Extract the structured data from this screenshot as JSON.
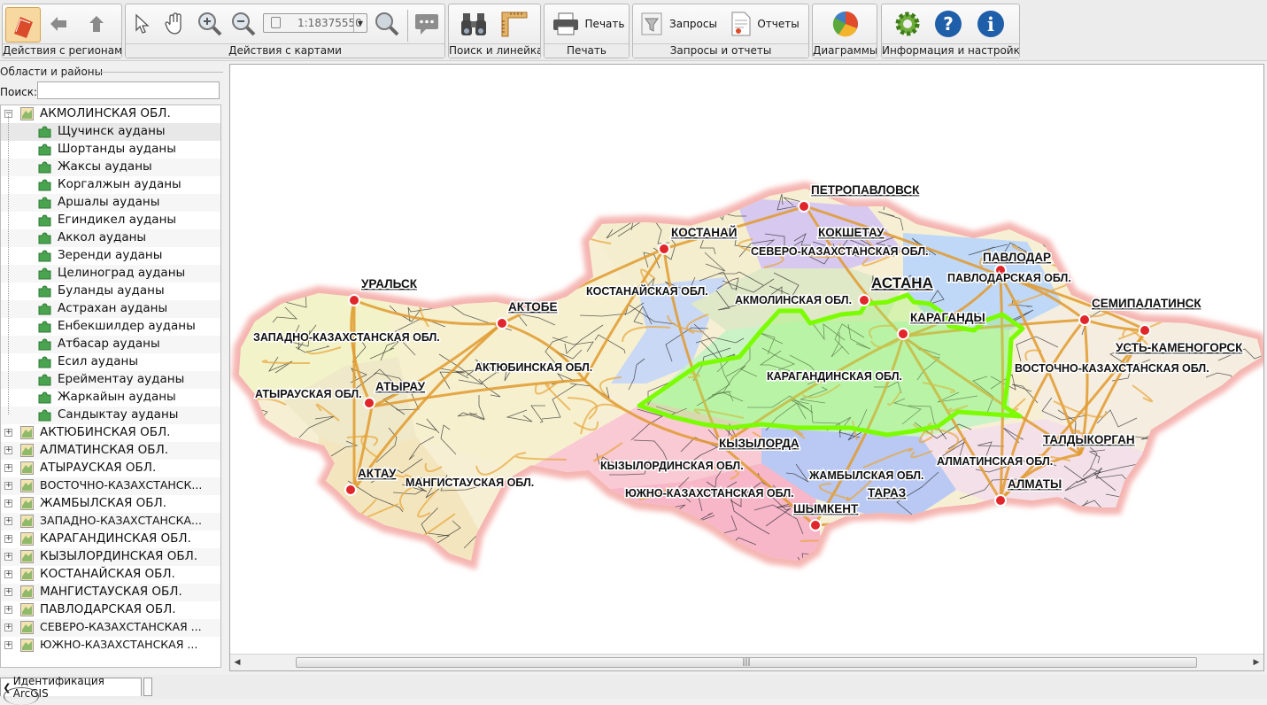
{
  "toolbar": {
    "groups": [
      {
        "label": "Действия с регионами"
      },
      {
        "label": "Действия с картами"
      },
      {
        "label": "Поиск и линейка"
      },
      {
        "label": "Печать"
      },
      {
        "label": "Запросы и отчеты"
      },
      {
        "label": "Диаграммы"
      },
      {
        "label": "Информация и настройки"
      }
    ],
    "scale_value": "1:18375550",
    "print_label": "Печать",
    "queries_label": "Запросы",
    "reports_label": "Отчеты"
  },
  "left_panel": {
    "title": "Области и районы",
    "search_label": "Поиск:",
    "search_value": "",
    "expanded_region": "АКМОЛИНСКАЯ ОБЛ.",
    "districts": [
      "Щучинск ауданы",
      "Шортанды ауданы",
      "Жаксы ауданы",
      "Коргалжын ауданы",
      "Аршалы ауданы",
      "Егиндикел ауданы",
      "Аккол ауданы",
      "Зеренди ауданы",
      "Целиноград ауданы",
      "Буланды ауданы",
      "Астрахан ауданы",
      "Енбекшилдер ауданы",
      "Атбасар ауданы",
      "Есил ауданы",
      "Ерейментау ауданы",
      "Жаркайын ауданы",
      "Сандыктау ауданы"
    ],
    "regions": [
      "АКТЮБИНСКАЯ ОБЛ.",
      "АЛМАТИНСКАЯ ОБЛ.",
      "АТЫРАУСКАЯ ОБЛ.",
      "ВОСТОЧНО-КАЗАХСТАНСК...",
      "ЖАМБЫЛСКАЯ ОБЛ.",
      "ЗАПАДНО-КАЗАХСТАНСКА...",
      "КАРАГАНДИНСКАЯ ОБЛ.",
      "КЫЗЫЛОРДИНСКАЯ ОБЛ.",
      "КОСТАНАЙСКАЯ ОБЛ.",
      "МАНГИСТАУСКАЯ ОБЛ.",
      "ПАВЛОДАРСКАЯ ОБЛ.",
      "СЕВЕРО-КАЗАХСТАНСКАЯ ...",
      "ЮЖНО-КАЗАХСТАНСКАЯ ..."
    ]
  },
  "map": {
    "cities": [
      {
        "name": "ПЕТРОПАВЛОВСК"
      },
      {
        "name": "КОСТАНАЙ"
      },
      {
        "name": "КОКШЕТАУ"
      },
      {
        "name": "ПАВЛОДАР"
      },
      {
        "name": "УРАЛЬСК"
      },
      {
        "name": "АКТОБЕ"
      },
      {
        "name": "АСТАНА"
      },
      {
        "name": "СЕМИПАЛАТИНСК"
      },
      {
        "name": "КАРАГАНДЫ"
      },
      {
        "name": "УСТЬ-КАМЕНОГОРСК"
      },
      {
        "name": "АТЫРАУ"
      },
      {
        "name": "КЫЗЫЛОРДА"
      },
      {
        "name": "ТАЛДЫКОРГАН"
      },
      {
        "name": "АКТАУ"
      },
      {
        "name": "АЛМАТЫ"
      },
      {
        "name": "ТАРАЗ"
      },
      {
        "name": "ШЫМКЕНТ"
      }
    ],
    "regions": [
      {
        "name": "СЕВЕРО-КАЗАХСТАНСКАЯ ОБЛ."
      },
      {
        "name": "ПАВЛОДАРСКАЯ ОБЛ."
      },
      {
        "name": "КОСТАНАЙСКАЯ ОБЛ."
      },
      {
        "name": "АКМОЛИНСКАЯ ОБЛ."
      },
      {
        "name": "ЗАПАДНО-КАЗАХСТАНСКАЯ ОБЛ."
      },
      {
        "name": "ВОСТОЧНО-КАЗАХСТАНСКАЯ ОБЛ."
      },
      {
        "name": "АКТЮБИНСКАЯ ОБЛ."
      },
      {
        "name": "КАРАГАНДИНСКАЯ ОБЛ."
      },
      {
        "name": "АТЫРАУСКАЯ ОБЛ."
      },
      {
        "name": "АЛМАТИНСКАЯ ОБЛ."
      },
      {
        "name": "КЫЗЫЛОРДИНСКАЯ ОБЛ."
      },
      {
        "name": "МАНГИСТАУСКАЯ ОБЛ."
      },
      {
        "name": "ЖАМБЫЛСКАЯ ОБЛ."
      },
      {
        "name": "ЮЖНО-КАЗАХСТАНСКАЯ ОБЛ."
      }
    ],
    "highlight_color": "#7CFC00"
  },
  "status": {
    "tab_label": "Идентификация ArcGIS"
  }
}
